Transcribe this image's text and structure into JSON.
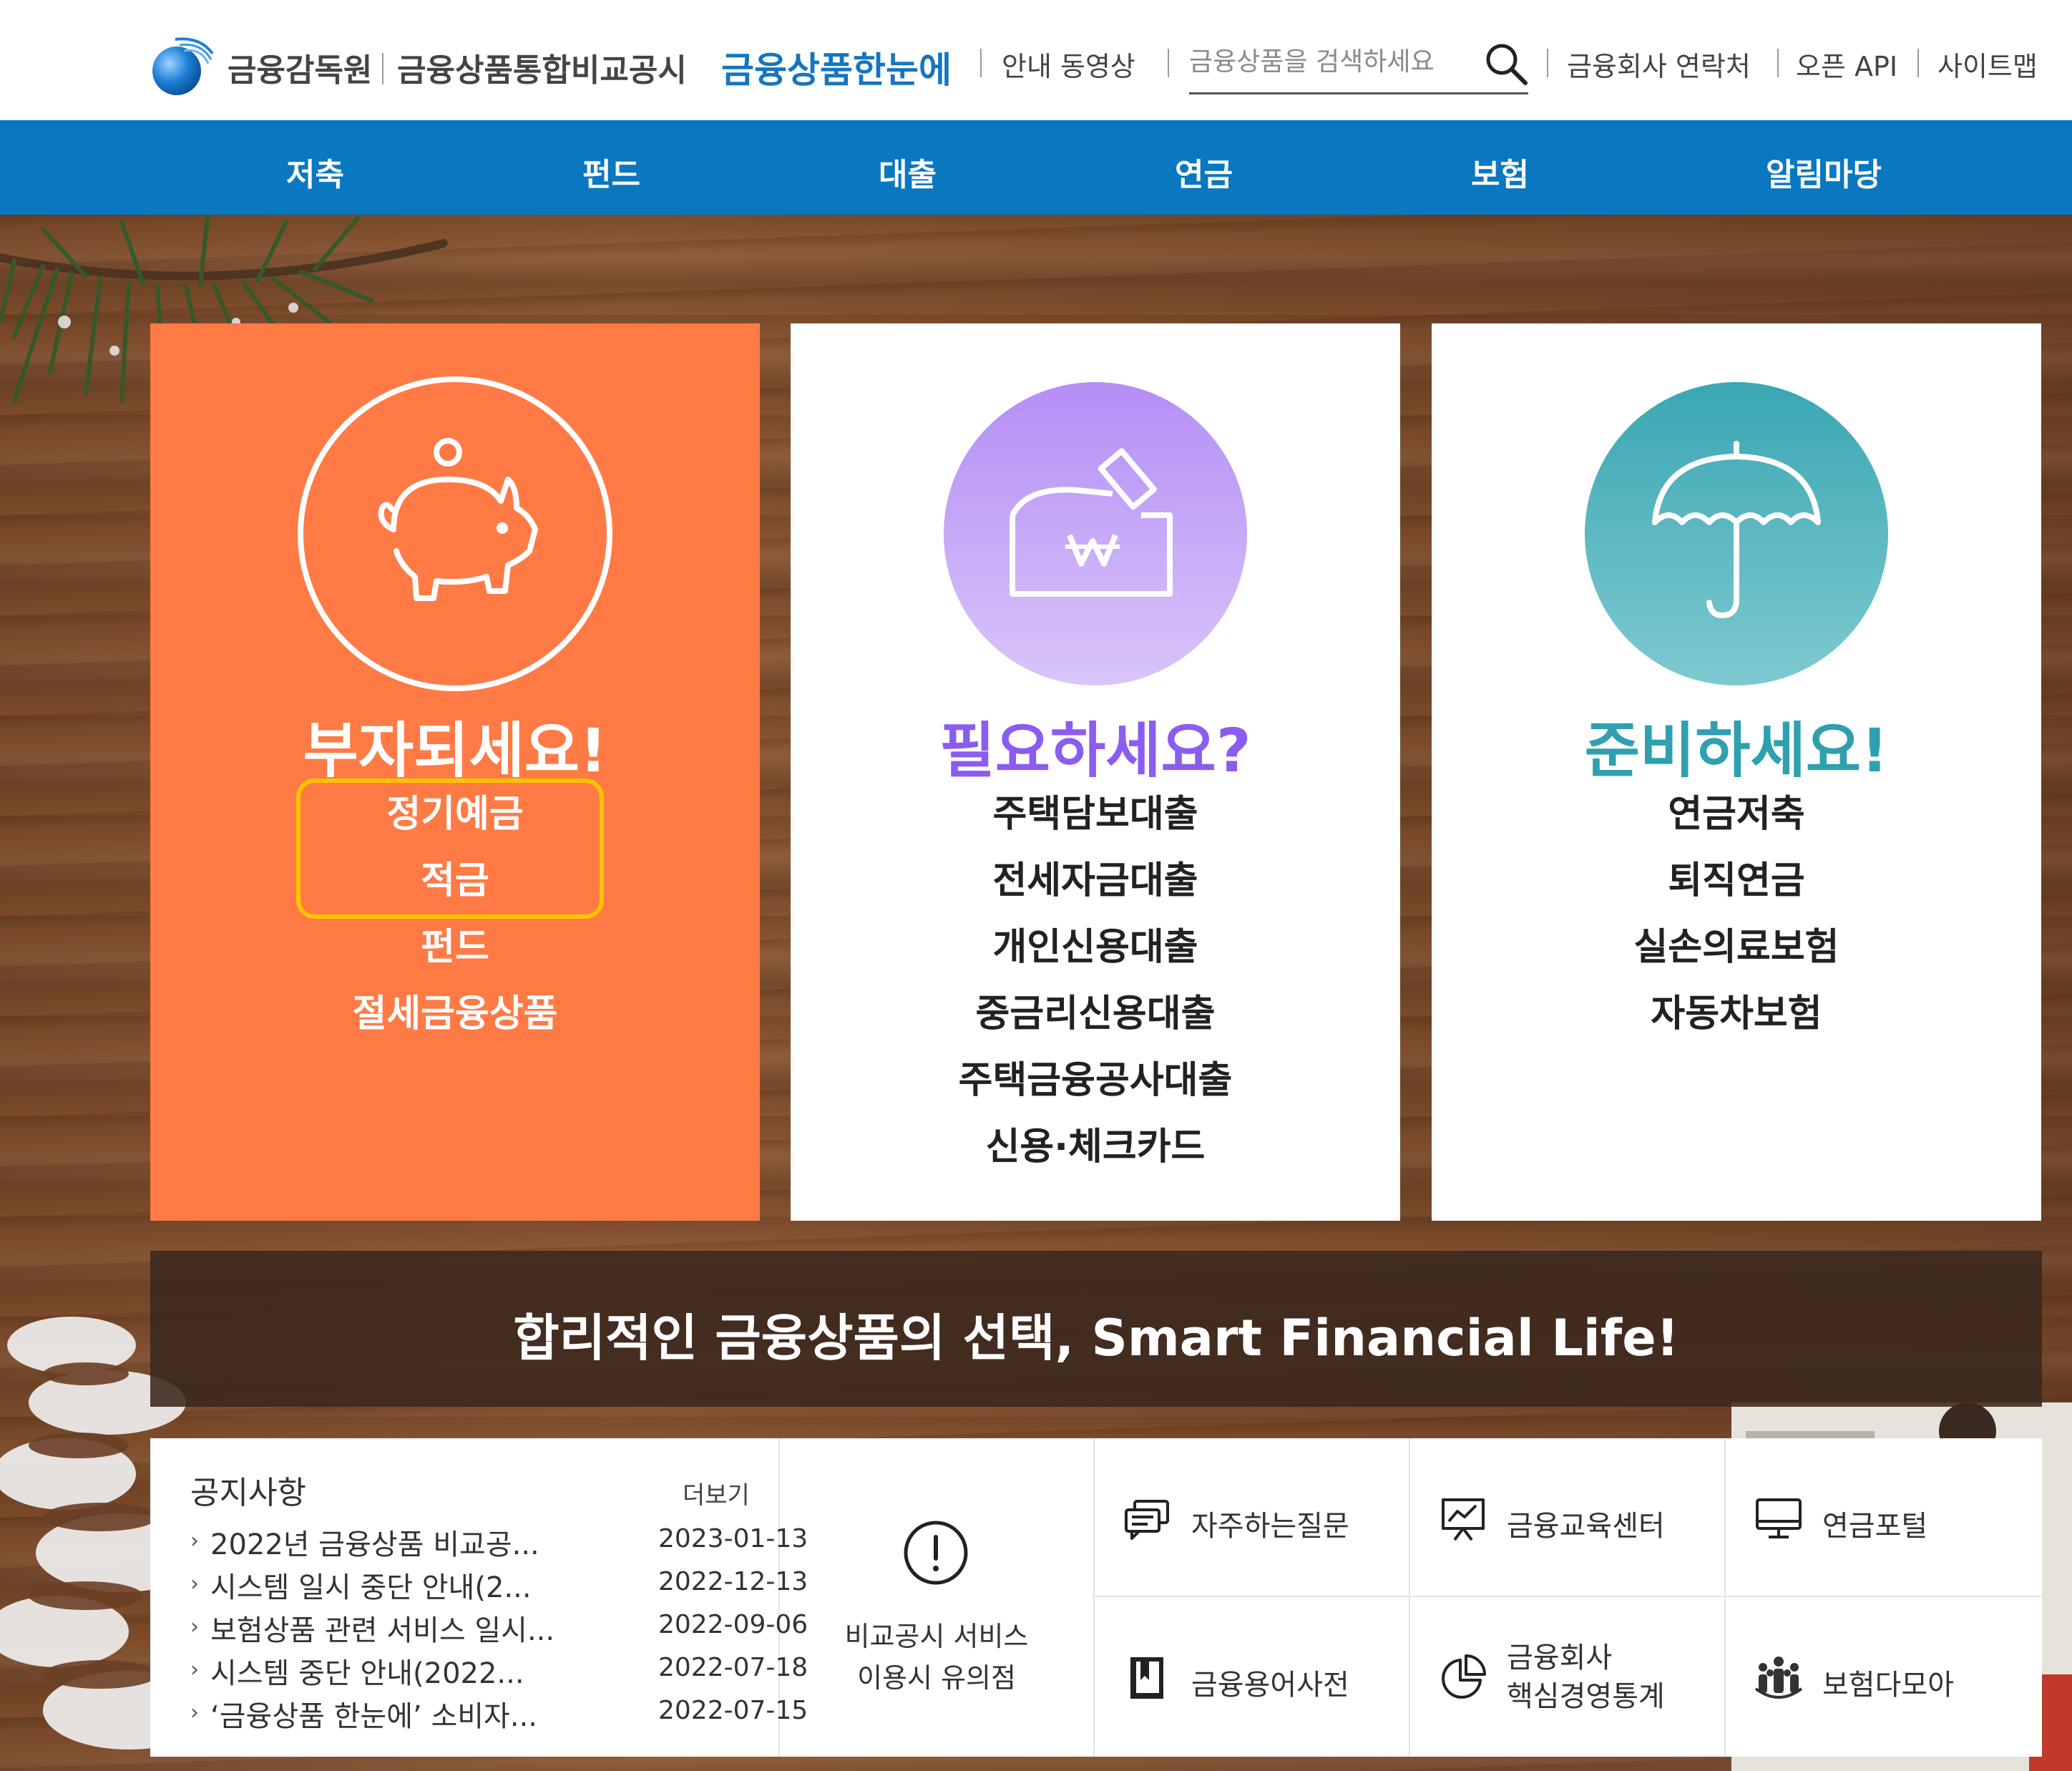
{
  "header": {
    "org_name": "금융감독원",
    "portal_name": "금융상품통합비교공시",
    "brand_name": "금융상품한눈에",
    "guide_video": "안내 동영상",
    "search_placeholder": "금융상품을 검색하세요",
    "company_contacts": "금융회사 연락처",
    "open_api": "오픈 API",
    "sitemap": "사이트맵"
  },
  "nav": {
    "items": [
      {
        "label": "저축"
      },
      {
        "label": "펀드"
      },
      {
        "label": "대출"
      },
      {
        "label": "연금"
      },
      {
        "label": "보험"
      },
      {
        "label": "알림마당"
      }
    ]
  },
  "cards": [
    {
      "title": "부자되세요!",
      "icon": "piggy-bank-icon",
      "items": [
        "정기예금",
        "적금",
        "펀드",
        "절세금융상품"
      ]
    },
    {
      "title": "필요하세요?",
      "icon": "money-envelope-icon",
      "items": [
        "주택담보대출",
        "전세자금대출",
        "개인신용대출",
        "중금리신용대출",
        "주택금융공사대출",
        "신용·체크카드"
      ]
    },
    {
      "title": "준비하세요!",
      "icon": "umbrella-icon",
      "items": [
        "연금저축",
        "퇴직연금",
        "실손의료보험",
        "자동차보험"
      ]
    }
  ],
  "slogan": "합리적인 금융상품의 선택, Smart Financial Life!",
  "notice": {
    "title": "공지사항",
    "more": "더보기",
    "rows": [
      {
        "text": "2022년 금융상품 비교공...",
        "date": "2023-01-13"
      },
      {
        "text": "시스템 일시 중단 안내(2...",
        "date": "2022-12-13"
      },
      {
        "text": "보험상품 관련 서비스 일시...",
        "date": "2022-09-06"
      },
      {
        "text": "시스템 중단 안내(2022...",
        "date": "2022-07-18"
      },
      {
        "text": "‘금융상품 한눈에’ 소비자...",
        "date": "2022-07-15"
      }
    ]
  },
  "caution": {
    "line1": "비교공시 서비스",
    "line2": "이용시 유의점"
  },
  "quick_links": [
    {
      "label": "자주하는질문",
      "icon": "chat-icon"
    },
    {
      "label": "금융교육센터",
      "icon": "presentation-icon"
    },
    {
      "label": "연금포털",
      "icon": "monitor-icon"
    },
    {
      "label": "금융용어사전",
      "icon": "dictionary-icon"
    },
    {
      "label_line1": "금융회사",
      "label_line2": "핵심경영통계",
      "icon": "pie-chart-icon"
    },
    {
      "label": "보험다모아",
      "icon": "people-icon"
    }
  ],
  "colors": {
    "nav_blue": "#0a77c1",
    "brand_blue": "#1575c0",
    "save_orange": "#ff7a45",
    "loan_purple": "#8b5cf0",
    "ready_teal": "#2fa0b0",
    "highlight_yellow": "#ffc400"
  }
}
